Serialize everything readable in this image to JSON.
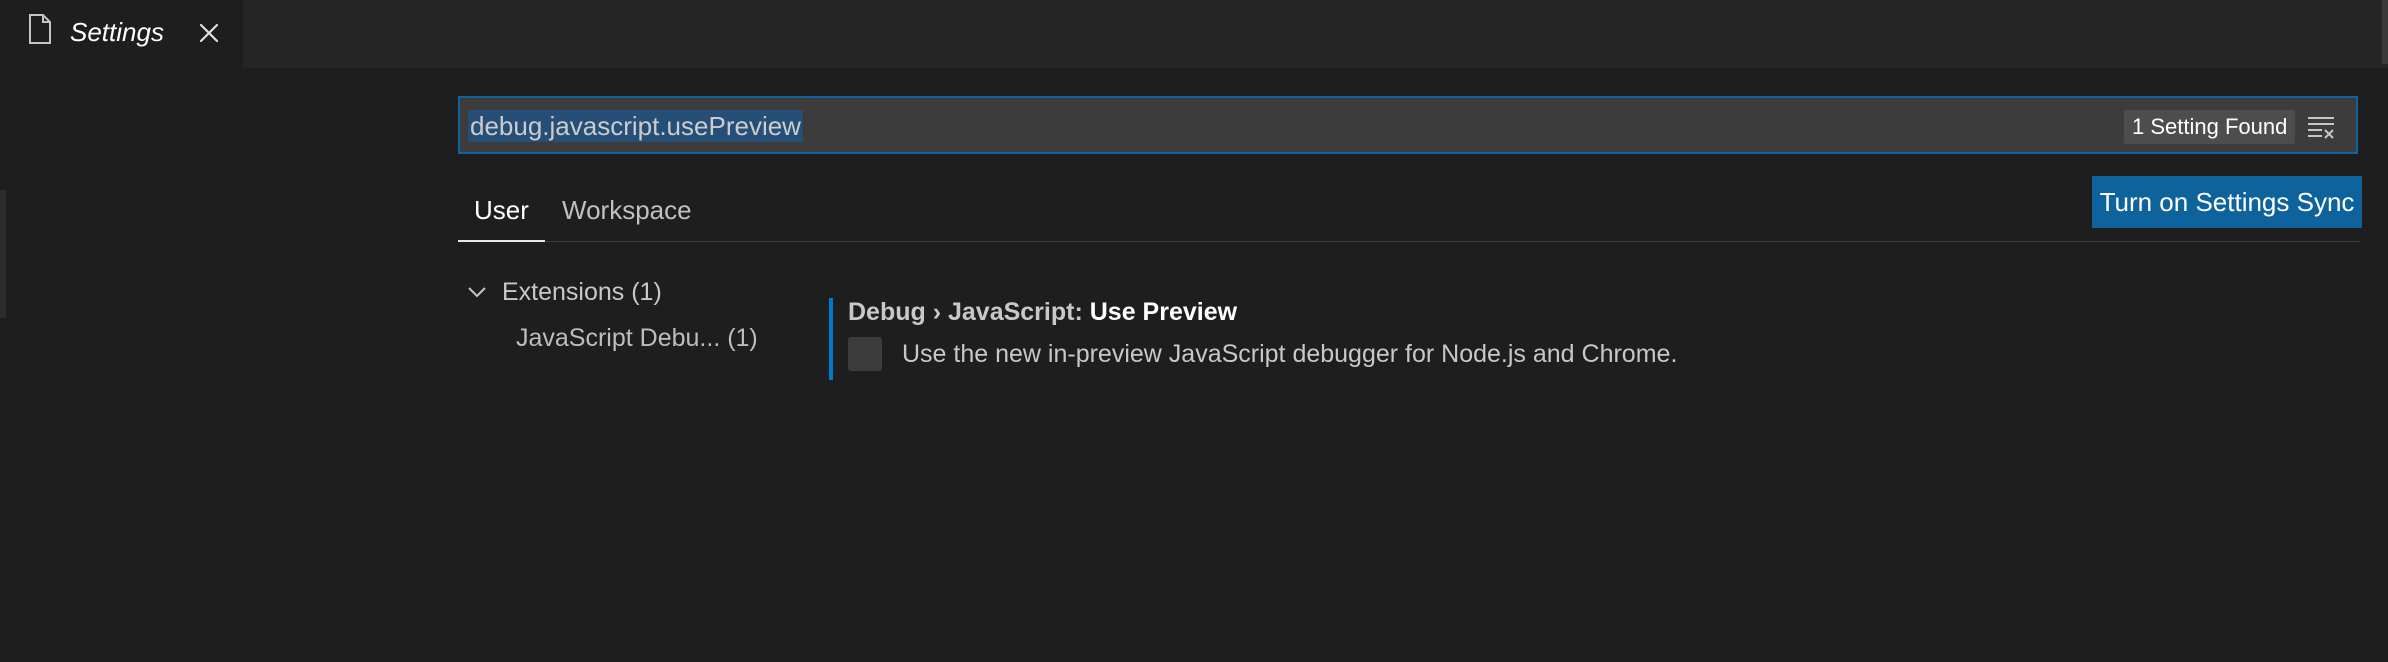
{
  "editor_tab": {
    "title": "Settings",
    "file_icon": "file-icon",
    "close_icon": "close-icon"
  },
  "search": {
    "value": "debug.javascript.usePreview",
    "result_count": "1 Setting Found",
    "clear_icon": "clear-filter-icon"
  },
  "scope_tabs": [
    {
      "label": "User",
      "active": true
    },
    {
      "label": "Workspace",
      "active": false
    }
  ],
  "sync_button": {
    "label": "Turn on Settings Sync"
  },
  "toc": {
    "group": {
      "label": "Extensions (1)",
      "expanded": true,
      "icon": "chevron-down-icon"
    },
    "items": [
      {
        "label": "JavaScript Debu... (1)"
      }
    ]
  },
  "setting": {
    "category": "Debug › JavaScript: ",
    "name": "Use Preview",
    "description": "Use the new in-preview JavaScript debugger for Node.js and Chrome.",
    "checked": false
  },
  "colors": {
    "background": "#1e1e1e",
    "tab_bar": "#252526",
    "accent": "#007acc",
    "button": "#0e639c",
    "input": "#3c3c3c",
    "selection": "#264f78"
  }
}
